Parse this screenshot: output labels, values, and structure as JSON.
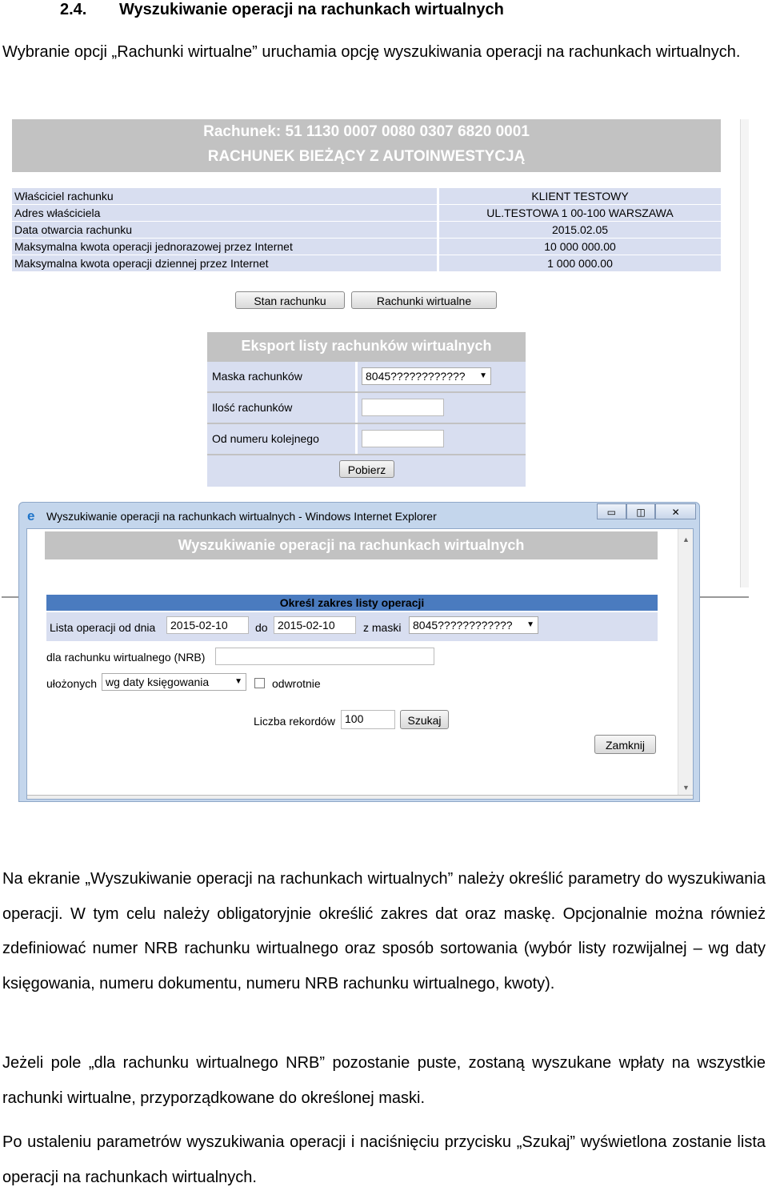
{
  "heading": {
    "number": "2.4.",
    "title": "Wyszukiwanie operacji na rachunkach wirtualnych"
  },
  "intro": "Wybranie opcji „Rachunki wirtualne” uruchamia opcję wyszukiwania operacji na rachunkach wirtualnych.",
  "account": {
    "title": "Rachunek: 51 1130 0007 0080 0307 6820 0001",
    "subtitle": "RACHUNEK BIEŻĄCY Z AUTOINWESTYCJĄ",
    "rows": [
      {
        "label": "Właściciel rachunku",
        "value": "KLIENT TESTOWY"
      },
      {
        "label": "Adres właściciela",
        "value": "UL.TESTOWA 1 00-100 WARSZAWA"
      },
      {
        "label": "Data otwarcia rachunku",
        "value": "2015.02.05"
      },
      {
        "label": "Maksymalna kwota operacji jednorazowej przez Internet",
        "value": "10 000 000.00"
      },
      {
        "label": "Maksymalna kwota operacji dziennej przez Internet",
        "value": "1 000 000.00"
      }
    ],
    "buttons": {
      "balance": "Stan rachunku",
      "virtual": "Rachunki wirtualne"
    }
  },
  "export": {
    "title": "Eksport listy rachunków wirtualnych",
    "mask_label": "Maska rachunków",
    "mask_value": "8045????????????",
    "count_label": "Ilość rachunków",
    "from_label": "Od numeru kolejnego",
    "fetch_button": "Pobierz"
  },
  "window": {
    "title": "Wyszukiwanie operacji na rachunkach wirtualnych - Windows Internet Explorer",
    "controls": {
      "min": "▭",
      "max": "◫",
      "close": "✕"
    }
  },
  "search": {
    "title": "Wyszukiwanie operacji na rachunkach wirtualnych",
    "range_header": "Określ zakres listy operacji",
    "from_label": "Lista operacji od dnia",
    "from_value": "2015-02-10",
    "to_label": "do",
    "to_value": "2015-02-10",
    "mask_label": "z maski",
    "mask_value": "8045????????????",
    "nrb_label": "dla rachunku wirtualnego (NRB)",
    "sort_label": "ułożonych",
    "sort_value": "wg daty księgowania",
    "reverse_label": "odwrotnie",
    "records_label": "Liczba rekordów",
    "records_value": "100",
    "search_button": "Szukaj",
    "close_button": "Zamknij"
  },
  "body_paragraphs": [
    "Na ekranie „Wyszukiwanie operacji na rachunkach wirtualnych” należy określić parametry do wyszukiwania operacji. W tym celu należy obligatoryjnie określić zakres dat oraz maskę. Opcjonalnie można również zdefiniować numer NRB rachunku wirtualnego oraz sposób sortowania (wybór listy rozwijalnej – wg daty księgowania, numeru dokumentu, numeru NRB rachunku wirtualnego, kwoty).",
    "Jeżeli pole „dla rachunku wirtualnego NRB” pozostanie puste, zostaną wyszukane wpłaty na wszystkie rachunki wirtualne, przyporządkowane do określonej maski.",
    "Po ustaleniu parametrów wyszukiwania operacji i naciśnięciu przycisku „Szukaj” wyświetlona zostanie lista operacji na rachunkach wirtualnych."
  ]
}
